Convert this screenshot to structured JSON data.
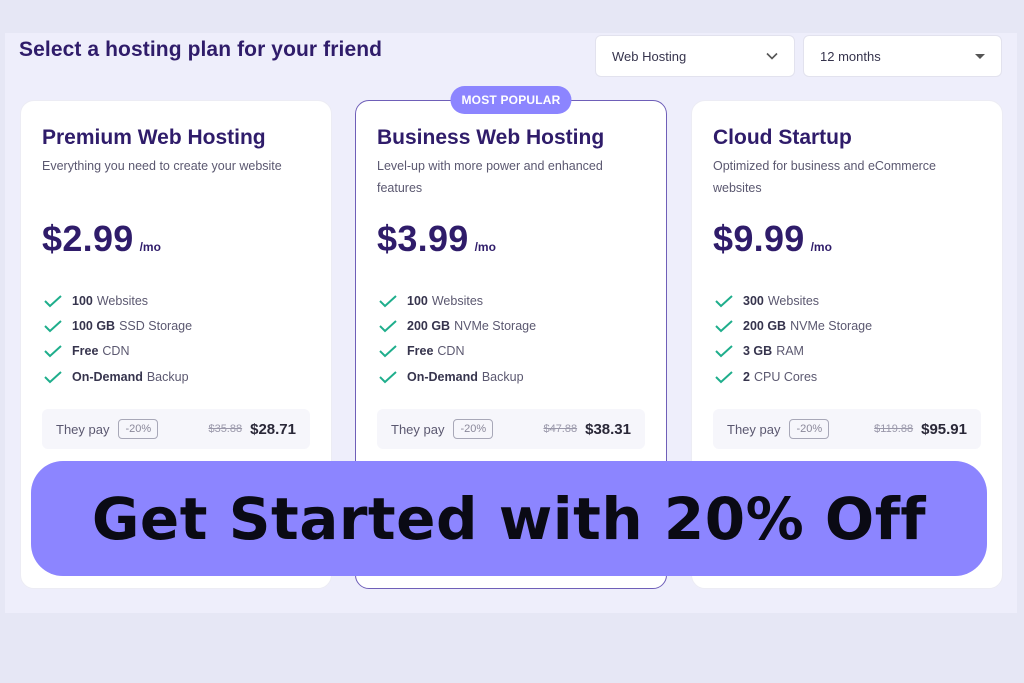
{
  "header": {
    "title": "Select a hosting plan for your friend",
    "category_select": {
      "value": "Web Hosting",
      "icon": "chevron-down-icon"
    },
    "period_select": {
      "value": "12 months",
      "icon": "caret-down-icon"
    }
  },
  "plans": [
    {
      "name": "Premium Web Hosting",
      "description": "Everything you need to create your website",
      "price": "$2.99",
      "per": "/mo",
      "features": [
        {
          "bold": "100",
          "text": "Websites"
        },
        {
          "bold": "100 GB",
          "text": "SSD Storage"
        },
        {
          "bold": "Free",
          "text": "CDN"
        },
        {
          "bold": "On-Demand",
          "text": "Backup"
        }
      ],
      "pay_label": "They pay",
      "discount": "-20%",
      "old_price": "$35.88",
      "new_price": "$28.71"
    },
    {
      "badge": "MOST POPULAR",
      "name": "Business Web Hosting",
      "description": "Level-up with more power and enhanced features",
      "price": "$3.99",
      "per": "/mo",
      "features": [
        {
          "bold": "100",
          "text": "Websites"
        },
        {
          "bold": "200 GB",
          "text": "NVMe Storage"
        },
        {
          "bold": "Free",
          "text": "CDN"
        },
        {
          "bold": "On-Demand",
          "text": "Backup"
        }
      ],
      "pay_label": "They pay",
      "discount": "-20%",
      "old_price": "$47.88",
      "new_price": "$38.31"
    },
    {
      "name": "Cloud Startup",
      "description": "Optimized for business and eCommerce websites",
      "price": "$9.99",
      "per": "/mo",
      "features": [
        {
          "bold": "300",
          "text": "Websites"
        },
        {
          "bold": "200 GB",
          "text": "NVMe Storage"
        },
        {
          "bold": "3 GB",
          "text": "RAM"
        },
        {
          "bold": "2",
          "text": "CPU Cores"
        }
      ],
      "pay_label": "They pay",
      "discount": "-20%",
      "old_price": "$119.88",
      "new_price": "$95.91"
    }
  ],
  "cta": {
    "label": "Get Started with 20% Off"
  },
  "colors": {
    "accent": "#8c85ff",
    "title": "#2f1c6a",
    "check": "#1fae8c",
    "popular_border": "#6f5fb8"
  }
}
